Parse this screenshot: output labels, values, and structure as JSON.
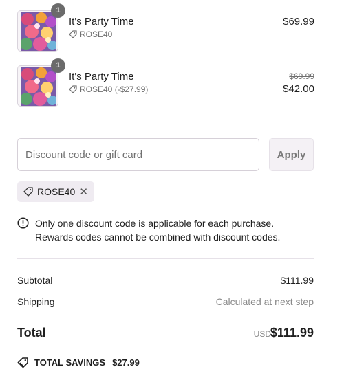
{
  "line_items": [
    {
      "title": "It's Party Time",
      "quantity": "1",
      "discount_label": "ROSE40",
      "price": "$69.99",
      "original_price": "",
      "discounted_price": ""
    },
    {
      "title": "It's Party Time",
      "quantity": "1",
      "discount_label": "ROSE40 (-$27.99)",
      "price": "",
      "original_price": "$69.99",
      "discounted_price": "$42.00"
    }
  ],
  "discount": {
    "placeholder": "Discount code or gift card",
    "value": "",
    "apply_label": "Apply",
    "applied_code": "ROSE40",
    "remove_glyph": "✕"
  },
  "notice": {
    "line1": "Only one discount code is applicable for each purchase.",
    "line2": "Rewards codes cannot be combined with discount codes."
  },
  "summary": {
    "subtotal_label": "Subtotal",
    "subtotal_value": "$111.99",
    "shipping_label": "Shipping",
    "shipping_value": "Calculated at next step",
    "total_label": "Total",
    "currency": "USD",
    "total_value": "$111.99",
    "savings_label": "TOTAL SAVINGS",
    "savings_value": "$27.99"
  },
  "icons": {
    "tag": "tag-icon",
    "info": "info-circle-icon",
    "close": "close-icon",
    "savings": "savings-tag-icon"
  }
}
